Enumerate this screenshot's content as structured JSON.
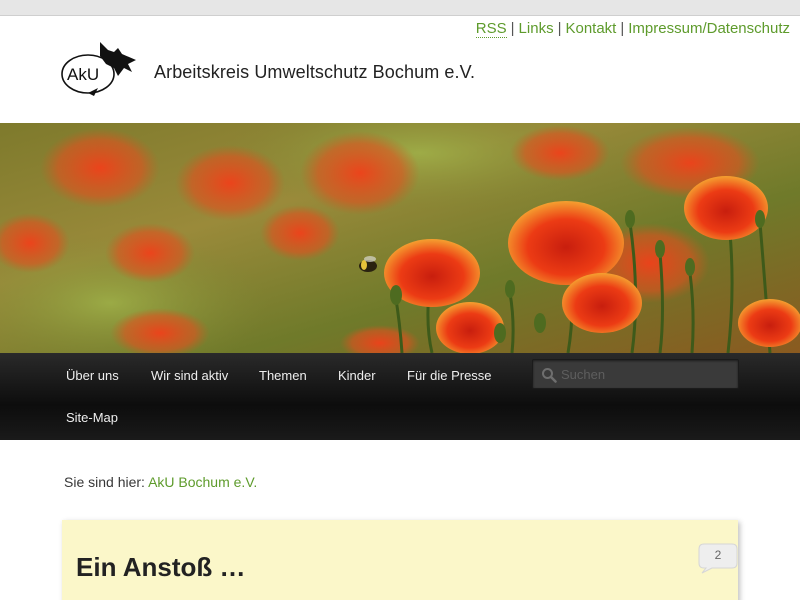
{
  "top_links": {
    "rss": "RSS",
    "links": "Links",
    "kontakt": "Kontakt",
    "impressum": "Impressum/Datenschutz",
    "separator": "|"
  },
  "logo": {
    "mark_text": "AkU",
    "org_name": "Arbeitskreis Umweltschutz Bochum e.V."
  },
  "nav": {
    "items": [
      "Über uns",
      "Wir sind aktiv",
      "Themen",
      "Kinder",
      "Für die Presse",
      "Site-Map"
    ],
    "search_placeholder": "Suchen"
  },
  "breadcrumb": {
    "prefix": "Sie sind hier:",
    "current": "AkU Bochum e.V."
  },
  "post": {
    "title": "Ein Anstoß …",
    "comment_count": "2"
  },
  "colors": {
    "link_green": "#5e9b2c",
    "nav_background": "#111111",
    "post_background": "#fbf7c9"
  }
}
